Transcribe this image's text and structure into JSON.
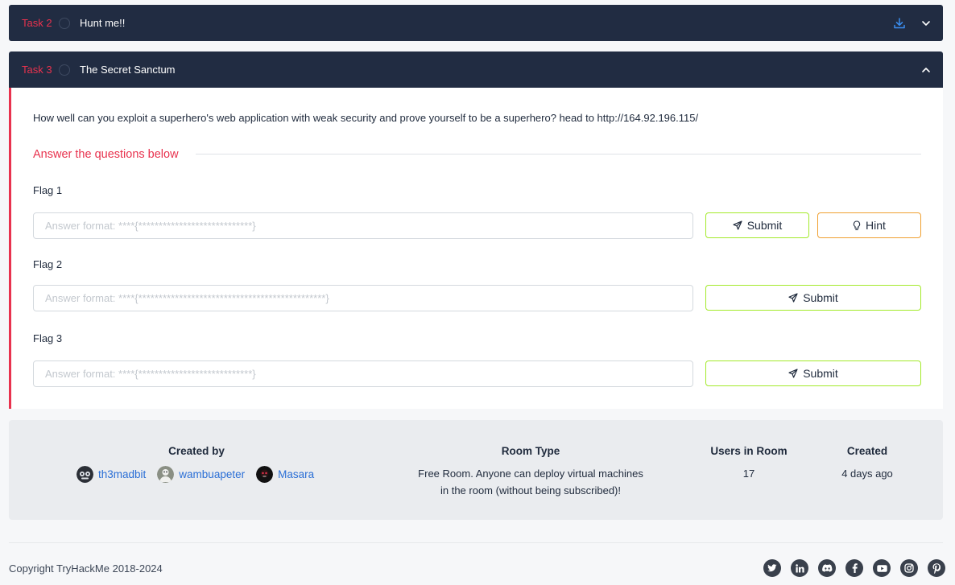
{
  "task2": {
    "num": "Task 2",
    "title": "Hunt me!!"
  },
  "task3": {
    "num": "Task 3",
    "title": "The Secret Sanctum",
    "description": "How well can you exploit a superhero's web application with weak security and prove yourself to be a superhero? head to http://164.92.196.115/",
    "answer_heading": "Answer the questions below",
    "questions": [
      {
        "label": "Flag 1",
        "placeholder": "Answer format: ****{****************************}",
        "submit": "Submit",
        "hint": "Hint"
      },
      {
        "label": "Flag 2",
        "placeholder": "Answer format: ****{**********************************************}",
        "submit": "Submit"
      },
      {
        "label": "Flag 3",
        "placeholder": "Answer format: ****{****************************}",
        "submit": "Submit"
      }
    ]
  },
  "room_info": {
    "created_by_label": "Created by",
    "creators": [
      "th3madbit",
      "wambuapeter",
      "Masara"
    ],
    "room_type_label": "Room Type",
    "room_type_line1": "Free Room. Anyone can deploy virtual machines",
    "room_type_line2": "in the room (without being subscribed)!",
    "users_label": "Users in Room",
    "users_value": "17",
    "created_label": "Created",
    "created_value": "4 days ago"
  },
  "footer": {
    "copyright": "Copyright TryHackMe 2018-2024",
    "socials": [
      "twitter-icon",
      "linkedin-icon",
      "discord-icon",
      "facebook-icon",
      "youtube-icon",
      "instagram-icon",
      "pinterest-icon"
    ]
  },
  "colors": {
    "header_bg": "#212c42",
    "accent_red": "#e8324e",
    "submit_border": "#a3ea2a",
    "hint_border": "#f0a030",
    "link": "#2b6fd6"
  }
}
